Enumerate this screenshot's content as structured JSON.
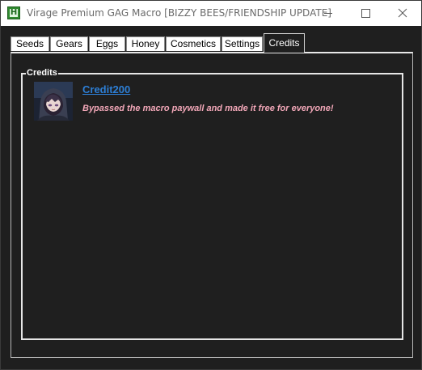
{
  "window": {
    "title": "Virage Premium GAG Macro [BIZZY BEES/FRIENDSHIP UPDATE]",
    "icon": "app-h-icon"
  },
  "tabs": [
    {
      "label": "Seeds",
      "active": false
    },
    {
      "label": "Gears",
      "active": false
    },
    {
      "label": "Eggs",
      "active": false
    },
    {
      "label": "Honey",
      "active": false
    },
    {
      "label": "Cosmetics",
      "active": false
    },
    {
      "label": "Settings",
      "active": false
    },
    {
      "label": "Credits",
      "active": true
    }
  ],
  "credits": {
    "group_title": "Credits",
    "entry": {
      "name": "Credit200",
      "description": "Bypassed the macro paywall and made it free for everyone!"
    }
  },
  "colors": {
    "background": "#1f1f1f",
    "link": "#2d7fd6",
    "description": "#f2a7b8",
    "tab_bg": "#ffffff"
  }
}
